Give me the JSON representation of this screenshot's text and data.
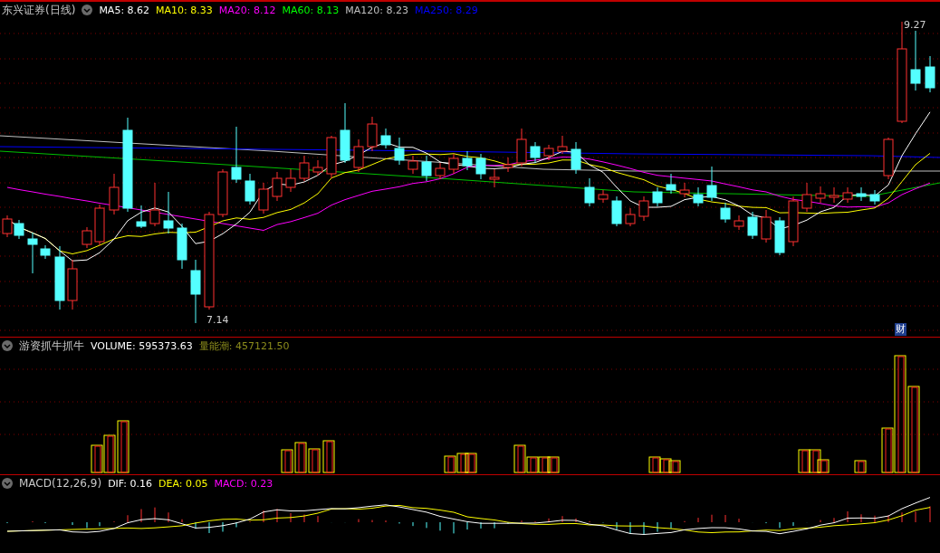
{
  "main_panel": {
    "title": "东兴证券(日线)",
    "legend": [
      {
        "label": "MA5: 8.62",
        "color": "#ffffff"
      },
      {
        "label": "MA10: 8.33",
        "color": "#ffff00"
      },
      {
        "label": "MA20: 8.12",
        "color": "#ff00ff"
      },
      {
        "label": "MA60: 8.13",
        "color": "#00ff00"
      },
      {
        "label": "MA120: 8.23",
        "color": "#c0c0c0"
      },
      {
        "label": "MA250: 8.29",
        "color": "#0000ff"
      }
    ],
    "high_label": "9.27",
    "low_label": "7.14",
    "badge": "财"
  },
  "volume_panel": {
    "title": "游资抓牛抓牛",
    "legend": [
      {
        "label": "VOLUME: 595373.63",
        "color": "#ffffff"
      },
      {
        "label": "量能潮: 457121.50",
        "color": "#8c8c1c"
      }
    ]
  },
  "macd_panel": {
    "title": "MACD(12,26,9)",
    "legend": [
      {
        "label": "DIF: 0.16",
        "color": "#ffffff"
      },
      {
        "label": "DEA: 0.05",
        "color": "#ffff00"
      },
      {
        "label": "MACD: 0.23",
        "color": "#ff00ff"
      }
    ]
  }
}
